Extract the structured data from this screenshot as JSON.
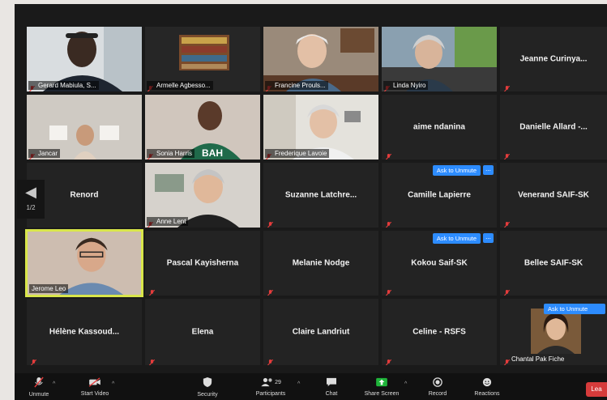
{
  "participants": [
    {
      "name": "Gerard Mabiula, S...",
      "shown": "tag"
    },
    {
      "name": "Armelle  Agbesso...",
      "shown": "tag"
    },
    {
      "name": "Francine Prouls...",
      "shown": "tag"
    },
    {
      "name": "Linda Nyiro",
      "shown": "tag"
    },
    {
      "name": "Jeanne  Curinya...",
      "shown": "center"
    },
    {
      "name": "Jancar",
      "shown": "tag"
    },
    {
      "name": "Sonia Harris",
      "shown": "tag"
    },
    {
      "name": "Frederique Lavoie",
      "shown": "tag"
    },
    {
      "name": "aime ndanina",
      "shown": "center"
    },
    {
      "name": "Danielle  Allard -...",
      "shown": "center"
    },
    {
      "name": "Renord",
      "shown": "center"
    },
    {
      "name": "Anne Lent",
      "shown": "tag"
    },
    {
      "name": "Suzanne  Latchre...",
      "shown": "center"
    },
    {
      "name": "Camille Lapierre",
      "shown": "center"
    },
    {
      "name": "Venerand SAIF-SK",
      "shown": "center"
    },
    {
      "name": "Jerome Leo",
      "shown": "tag"
    },
    {
      "name": "Pascal Kayisherna",
      "shown": "center"
    },
    {
      "name": "Melanie Nodge",
      "shown": "center"
    },
    {
      "name": "Kokou Saif-SK",
      "shown": "center"
    },
    {
      "name": "Bellee SAIF-SK",
      "shown": "center"
    },
    {
      "name": "Hélène  Kassoud...",
      "shown": "center"
    },
    {
      "name": "Elena",
      "shown": "center"
    },
    {
      "name": "Claire Landriut",
      "shown": "center"
    },
    {
      "name": "Celine - RSFS",
      "shown": "center"
    },
    {
      "name": "Chantal Pak Fiche",
      "shown": "tag"
    }
  ],
  "ask_to_unmute_label": "Ask to Unmute",
  "more_options_label": "...",
  "pager": {
    "arrow": "◀",
    "page": "1/2"
  },
  "toolbar": {
    "unmute": "Unmute",
    "start_video": "Start Video",
    "security": "Security",
    "participants": "Participants",
    "participants_count": "29",
    "chat": "Chat",
    "share_screen": "Share Screen",
    "record": "Record",
    "reactions": "Reactions",
    "leave": "Lea"
  },
  "colors": {
    "active_speaker": "#d9e64a",
    "muted": "#e53c3c",
    "accent": "#2d8cff",
    "share": "#1fb53a"
  }
}
